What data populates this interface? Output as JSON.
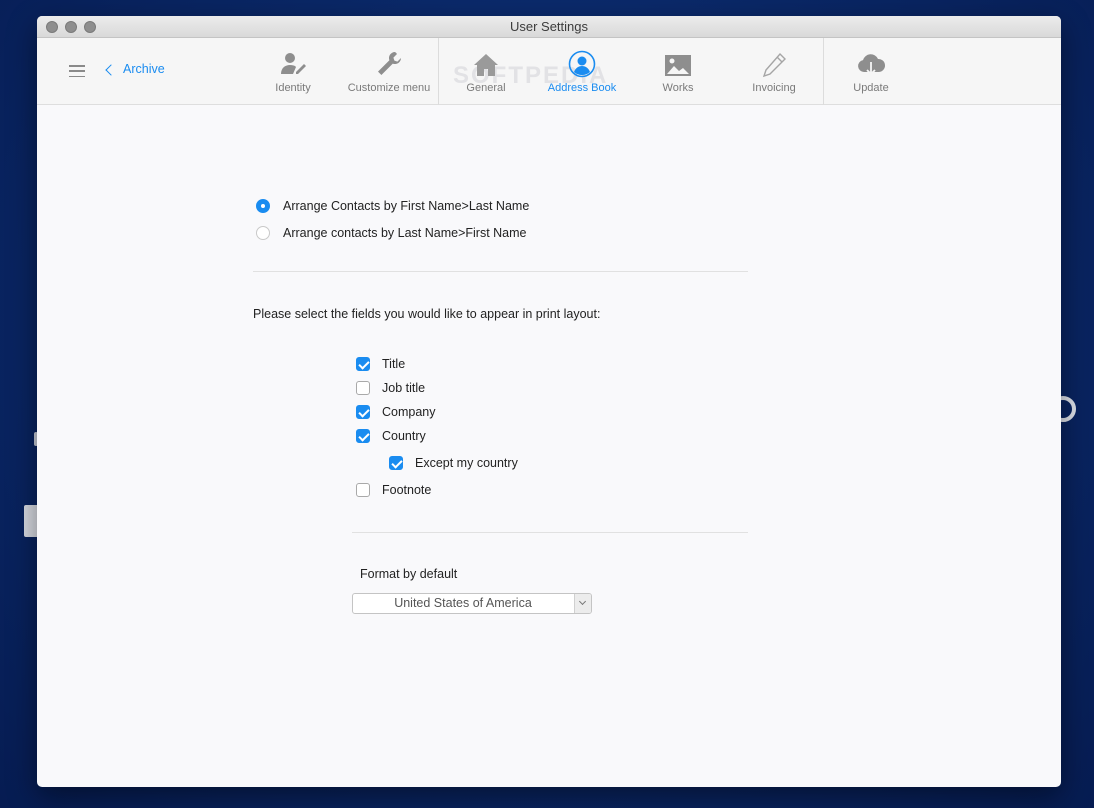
{
  "window": {
    "title": "User Settings"
  },
  "toolbar": {
    "back_label": "Archive",
    "tabs": [
      {
        "label": "Identity",
        "icon": "identity-icon"
      },
      {
        "label": "Customize menu",
        "icon": "wrench-icon"
      },
      {
        "label": "General",
        "icon": "house-icon"
      },
      {
        "label": "Address Book",
        "icon": "address-book-icon",
        "active": true
      },
      {
        "label": "Works",
        "icon": "image-icon"
      },
      {
        "label": "Invoicing",
        "icon": "pencil-icon"
      },
      {
        "label": "Update",
        "icon": "cloud-download-icon"
      }
    ]
  },
  "arrange": {
    "options": [
      {
        "label": "Arrange Contacts by First Name>Last Name",
        "selected": true
      },
      {
        "label": "Arrange contacts by Last Name>First Name",
        "selected": false
      }
    ]
  },
  "print_fields": {
    "prompt": "Please select the fields you would like to appear in print layout:",
    "items": [
      {
        "label": "Title",
        "checked": true
      },
      {
        "label": "Job title",
        "checked": false
      },
      {
        "label": "Company",
        "checked": true
      },
      {
        "label": "Country",
        "checked": true
      },
      {
        "label": "Except my country",
        "checked": true
      },
      {
        "label": "Footnote",
        "checked": false
      }
    ]
  },
  "format": {
    "label": "Format by default",
    "selected": "United States of America"
  },
  "watermark": "SOFTPEDIA",
  "colors": {
    "accent": "#1a8cf0",
    "background": "#0a2766"
  }
}
